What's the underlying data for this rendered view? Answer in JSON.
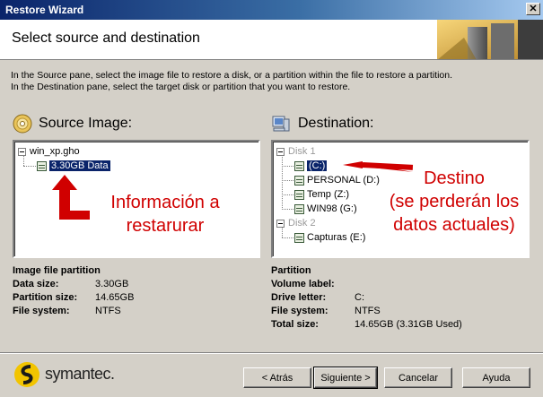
{
  "window": {
    "title": "Restore Wizard",
    "close_glyph": "✕"
  },
  "header": {
    "title": "Select source and destination"
  },
  "instructions": {
    "line1": "In the Source pane, select the image file to restore a disk, or a partition within the file to restore a partition.",
    "line2": "In the Destination pane, select the target disk or partition that you want to restore."
  },
  "source": {
    "title": "Source Image:",
    "icon": "cd-icon",
    "tree": {
      "file": "win_xp.gho",
      "partition": "3.30GB Data"
    },
    "info_title": "Image file partition",
    "fields": [
      {
        "label": "Data size:",
        "value": "3.30GB"
      },
      {
        "label": "Partition size:",
        "value": "14.65GB"
      },
      {
        "label": "File system:",
        "value": "NTFS"
      }
    ]
  },
  "destination": {
    "title": "Destination:",
    "icon": "computer-icon",
    "tree": {
      "disk1": "Disk 1",
      "disk1_partitions": [
        "(C:)",
        "PERSONAL (D:)",
        "Temp (Z:)",
        "WIN98 (G:)"
      ],
      "disk2": "Disk 2",
      "disk2_partitions": [
        "Capturas (E:)"
      ]
    },
    "info_title": "Partition",
    "fields": [
      {
        "label": "Volume label:",
        "value": ""
      },
      {
        "label": "Drive letter:",
        "value": "C:"
      },
      {
        "label": "File system:",
        "value": "NTFS"
      },
      {
        "label": "Total size:",
        "value": "14.65GB (3.31GB Used)"
      }
    ]
  },
  "annotations": {
    "source_line1": "Información a",
    "source_line2": "restarurar",
    "dest_line1": "Destino",
    "dest_line2": "(se perderán los",
    "dest_line3": "datos actuales)",
    "color": "#d00000"
  },
  "footer": {
    "logo_text": "symantec.",
    "back": "< Atrás",
    "next": "Siguiente >",
    "cancel": "Cancelar",
    "help": "Ayuda"
  }
}
